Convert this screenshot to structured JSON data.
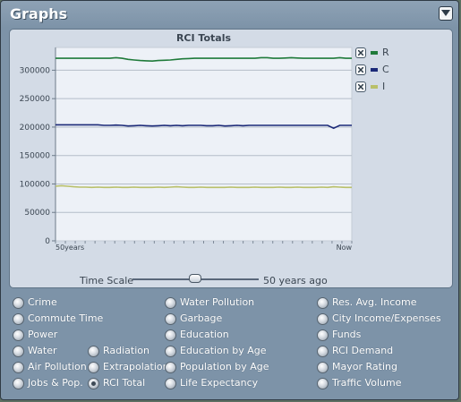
{
  "window": {
    "title": "Graphs",
    "collapse_icon": "chevron-down-icon"
  },
  "chart_data": {
    "type": "line",
    "title": "RCI Totals",
    "xlabel": "",
    "ylabel": "",
    "x_tick_labels": [
      "50years",
      "Now"
    ],
    "y_ticks": [
      0,
      50000,
      100000,
      150000,
      200000,
      250000,
      300000
    ],
    "ylim": [
      0,
      340000
    ],
    "grid": true,
    "legend_placement": "right",
    "series": [
      {
        "name": "R",
        "color": "#1f7a3a",
        "values": [
          321000,
          321000,
          321000,
          321000,
          321000,
          321000,
          321000,
          321000,
          321000,
          321000,
          322000,
          321000,
          319000,
          318000,
          317000,
          316500,
          316000,
          317000,
          317500,
          318000,
          319000,
          320000,
          320500,
          321000,
          321000,
          321000,
          321000,
          321000,
          321000,
          321000,
          321000,
          321000,
          321000,
          321000,
          322000,
          322000,
          321000,
          321000,
          321500,
          322000,
          321500,
          321000,
          321000,
          321000,
          321000,
          321000,
          321000,
          322000,
          321000,
          321000
        ]
      },
      {
        "name": "C",
        "color": "#1c2a78",
        "values": [
          204000,
          204000,
          204000,
          204000,
          204000,
          204000,
          204000,
          204000,
          203000,
          203000,
          203500,
          203000,
          202000,
          202500,
          203000,
          202500,
          202000,
          202500,
          203000,
          202500,
          203000,
          202500,
          203000,
          203000,
          203000,
          202500,
          202500,
          203000,
          202000,
          202500,
          203000,
          202500,
          203000,
          203000,
          203000,
          203000,
          203000,
          203000,
          203000,
          203000,
          203000,
          203000,
          203000,
          203000,
          203000,
          203000,
          198000,
          203000,
          203000,
          203000
        ]
      },
      {
        "name": "I",
        "color": "#b9c06a",
        "values": [
          96000,
          97000,
          96000,
          95000,
          94500,
          94500,
          94000,
          94500,
          94000,
          94000,
          94500,
          94000,
          94000,
          94500,
          94000,
          94000,
          94000,
          94500,
          94000,
          94500,
          95000,
          94500,
          94000,
          94000,
          94500,
          94000,
          94000,
          94000,
          94000,
          94500,
          94000,
          94000,
          94000,
          94500,
          94000,
          94000,
          94000,
          94500,
          94000,
          94000,
          94500,
          94000,
          94000,
          94000,
          94500,
          94000,
          95000,
          94500,
          94000,
          94000
        ]
      }
    ]
  },
  "time_scale": {
    "label": "Time Scale",
    "value": "50 years ago",
    "level_fraction": 0.45
  },
  "options": [
    {
      "label": "Crime",
      "selected": false
    },
    {
      "label": "Commute Time",
      "selected": false
    },
    {
      "label": "Power",
      "selected": false
    },
    {
      "label": "Water",
      "selected": false
    },
    {
      "label": "Air Pollution",
      "selected": false
    },
    {
      "label": "Jobs & Pop.",
      "selected": false
    },
    {
      "label": "Radiation",
      "selected": false
    },
    {
      "label": "Extrapolation",
      "selected": false
    },
    {
      "label": "RCI Total",
      "selected": true
    },
    {
      "label": "Water Pollution",
      "selected": false
    },
    {
      "label": "Garbage",
      "selected": false
    },
    {
      "label": "Education",
      "selected": false
    },
    {
      "label": "Education by Age",
      "selected": false
    },
    {
      "label": "Population by Age",
      "selected": false
    },
    {
      "label": "Life Expectancy",
      "selected": false
    },
    {
      "label": "Res. Avg. Income",
      "selected": false
    },
    {
      "label": "City Income/Expenses",
      "selected": false
    },
    {
      "label": "Funds",
      "selected": false
    },
    {
      "label": "RCI Demand",
      "selected": false
    },
    {
      "label": "Mayor Rating",
      "selected": false
    },
    {
      "label": "Traffic Volume",
      "selected": false
    }
  ]
}
